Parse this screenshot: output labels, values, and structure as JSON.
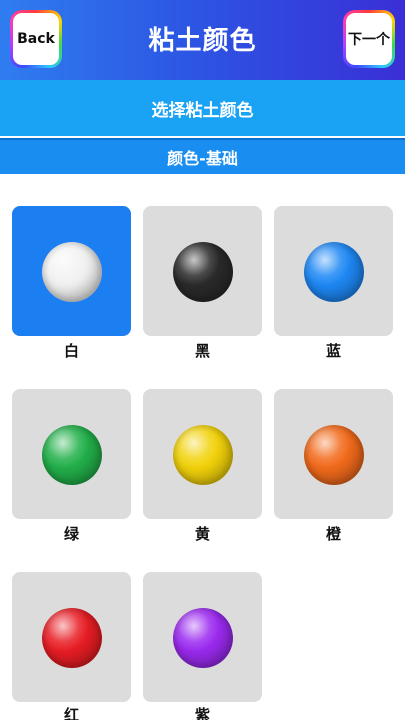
{
  "header": {
    "title": "粘土颜色",
    "back_label": "Back",
    "next_label": "下一个"
  },
  "subheader": {
    "prompt": "选择粘土颜色",
    "category": "颜色-基础"
  },
  "colors": [
    {
      "label": "白",
      "color": "#f2f2f2",
      "selected": true
    },
    {
      "label": "黑",
      "color": "#2a2a2a",
      "selected": false
    },
    {
      "label": "蓝",
      "color": "#1e88f5",
      "selected": false
    },
    {
      "label": "绿",
      "color": "#22b04a",
      "selected": false
    },
    {
      "label": "黄",
      "color": "#f2d20a",
      "selected": false
    },
    {
      "label": "橙",
      "color": "#f26a1b",
      "selected": false
    },
    {
      "label": "红",
      "color": "#e81d24",
      "selected": false
    },
    {
      "label": "紫",
      "color": "#9b2af0",
      "selected": false
    }
  ]
}
